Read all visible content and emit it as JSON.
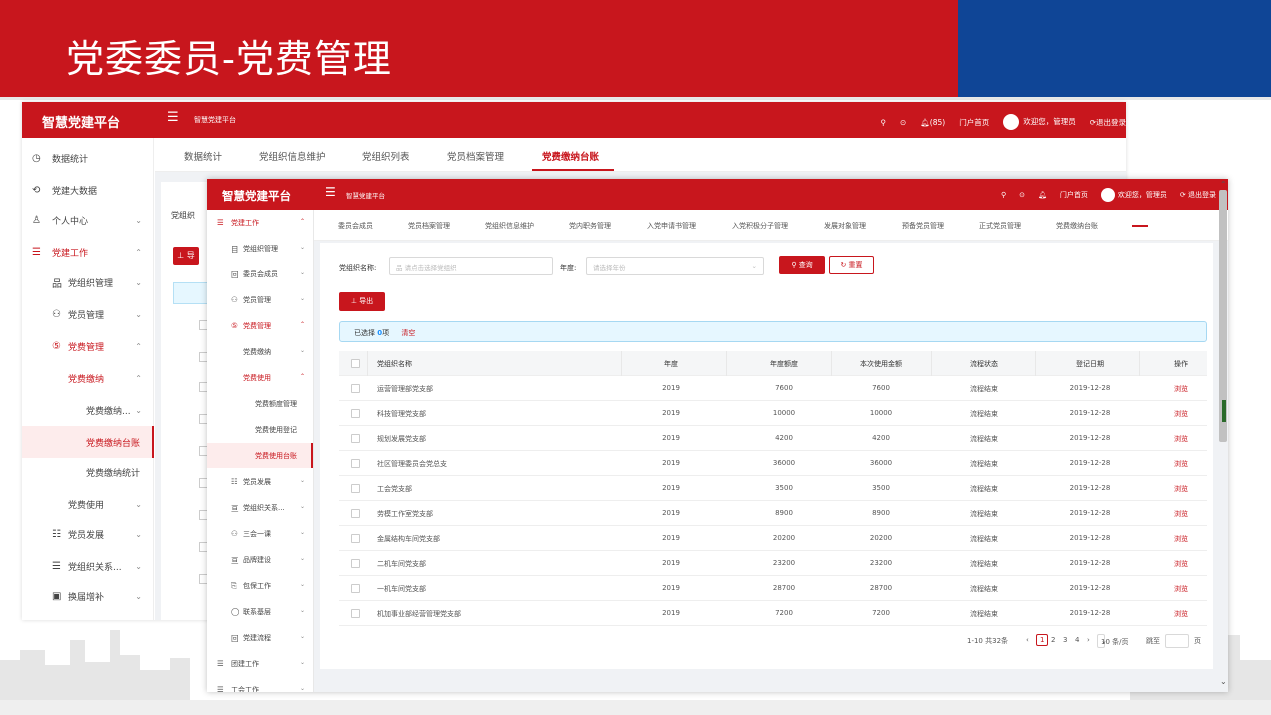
{
  "slide": {
    "title": "党委委员-党费管理"
  },
  "back_window": {
    "logo": "智慧党建平台",
    "brand": "智慧党建平台",
    "header_right": {
      "notifications": "(85)",
      "portal": "门户首页",
      "welcome": "欢迎您，管理员",
      "logout": "退出登录"
    },
    "sidebar": [
      {
        "icon": "◷",
        "label": "数据统计",
        "arrow": ""
      },
      {
        "icon": "⟲",
        "label": "党建大数据",
        "arrow": ""
      },
      {
        "icon": "♙",
        "label": "个人中心",
        "arrow": "⌄"
      },
      {
        "icon": "☰",
        "label": "党建工作",
        "arrow": "⌃"
      },
      {
        "icon": "品",
        "label": "党组织管理",
        "arrow": "⌄"
      },
      {
        "icon": "⚇",
        "label": "党员管理",
        "arrow": "⌄"
      },
      {
        "icon": "⑤",
        "label": "党费管理",
        "arrow": "⌃"
      },
      {
        "icon": "",
        "label": "党费缴纳",
        "arrow": "⌃"
      },
      {
        "icon": "",
        "label": "党费缴纳...",
        "arrow": "⌄"
      },
      {
        "icon": "",
        "label": "党费缴纳台账",
        "arrow": ""
      },
      {
        "icon": "",
        "label": "党费缴纳统计",
        "arrow": ""
      },
      {
        "icon": "",
        "label": "党费使用",
        "arrow": "⌄"
      },
      {
        "icon": "☷",
        "label": "党员发展",
        "arrow": "⌄"
      },
      {
        "icon": "☰",
        "label": "党组织关系...",
        "arrow": "⌄"
      },
      {
        "icon": "▣",
        "label": "换届增补",
        "arrow": "⌄"
      }
    ],
    "tabs": [
      "数据统计",
      "党组织信息维护",
      "党组织列表",
      "党员档案管理",
      "党费缴纳台账"
    ],
    "card_label": "党组织",
    "export_label": "⊥ 导"
  },
  "front_window": {
    "logo": "智慧党建平台",
    "brand": "智慧党建平台",
    "header_right": {
      "portal": "门户首页",
      "welcome": "欢迎您，管理员",
      "logout": "退出登录"
    },
    "sidebar": [
      {
        "icon": "☰",
        "label": "党建工作",
        "arrow": "⌃"
      },
      {
        "icon": "目",
        "label": "党组织管理",
        "arrow": "⌄"
      },
      {
        "icon": "回",
        "label": "委员会成员",
        "arrow": "⌄"
      },
      {
        "icon": "⚇",
        "label": "党员管理",
        "arrow": "⌄"
      },
      {
        "icon": "⑤",
        "label": "党费管理",
        "arrow": "⌃"
      },
      {
        "icon": "",
        "label": "党费缴纳",
        "arrow": "⌄"
      },
      {
        "icon": "",
        "label": "党费使用",
        "arrow": "⌃"
      },
      {
        "icon": "",
        "label": "党费额度管理",
        "arrow": ""
      },
      {
        "icon": "",
        "label": "党费使用登记",
        "arrow": ""
      },
      {
        "icon": "",
        "label": "党费使用台账",
        "arrow": ""
      },
      {
        "icon": "☷",
        "label": "党员发展",
        "arrow": "⌄"
      },
      {
        "icon": "亘",
        "label": "党组织关系...",
        "arrow": "⌄"
      },
      {
        "icon": "⚇",
        "label": "三会一课",
        "arrow": "⌄"
      },
      {
        "icon": "亘",
        "label": "品牌建设",
        "arrow": "⌄"
      },
      {
        "icon": "⎘",
        "label": "包保工作",
        "arrow": "⌄"
      },
      {
        "icon": "◯",
        "label": "联系基层",
        "arrow": "⌄"
      },
      {
        "icon": "回",
        "label": "党建流程",
        "arrow": "⌄"
      },
      {
        "icon": "☰",
        "label": "团建工作",
        "arrow": "⌄"
      },
      {
        "icon": "☰",
        "label": "工会工作",
        "arrow": "⌄"
      }
    ],
    "tabs": [
      "委员会成员",
      "党员档案管理",
      "党组织信息维护",
      "党内职务管理",
      "入党申请书管理",
      "入党积极分子管理",
      "发展对象管理",
      "预备党员管理",
      "正式党员管理",
      "党费缴纳台账"
    ],
    "filters": {
      "org_label": "党组织名称:",
      "org_placeholder": "请点击选择党组织",
      "year_label": "年度:",
      "year_placeholder": "请选择年份",
      "query_label": "查询",
      "reset_label": "重置"
    },
    "export_label": "导出",
    "alert": {
      "prefix": "已选择",
      "count": "0",
      "suffix": "项",
      "clear": "清空"
    },
    "table": {
      "headers": [
        "党组织名称",
        "年度",
        "年度额度",
        "本次使用金额",
        "流程状态",
        "登记日期",
        "操作"
      ],
      "rows": [
        [
          "运营管理部党支部",
          "2019",
          "7600",
          "7600",
          "流程结束",
          "2019-12-28",
          "浏览"
        ],
        [
          "科技管理党支部",
          "2019",
          "10000",
          "10000",
          "流程结束",
          "2019-12-28",
          "浏览"
        ],
        [
          "规划发展党支部",
          "2019",
          "4200",
          "4200",
          "流程结束",
          "2019-12-28",
          "浏览"
        ],
        [
          "社区管理委员会党总支",
          "2019",
          "36000",
          "36000",
          "流程结束",
          "2019-12-28",
          "浏览"
        ],
        [
          "工会党支部",
          "2019",
          "3500",
          "3500",
          "流程结束",
          "2019-12-28",
          "浏览"
        ],
        [
          "劳模工作室党支部",
          "2019",
          "8900",
          "8900",
          "流程结束",
          "2019-12-28",
          "浏览"
        ],
        [
          "金属结构车间党支部",
          "2019",
          "20200",
          "20200",
          "流程结束",
          "2019-12-28",
          "浏览"
        ],
        [
          "二机车间党支部",
          "2019",
          "23200",
          "23200",
          "流程结束",
          "2019-12-28",
          "浏览"
        ],
        [
          "一机车间党支部",
          "2019",
          "28700",
          "28700",
          "流程结束",
          "2019-12-28",
          "浏览"
        ],
        [
          "机加事业部经营管理党支部",
          "2019",
          "7200",
          "7200",
          "流程结束",
          "2019-12-28",
          "浏览"
        ]
      ]
    },
    "pager": {
      "total": "1-10 共32条",
      "pages": [
        "1",
        "2",
        "3",
        "4"
      ],
      "current": "1",
      "page_size": "10 条/页",
      "goto_label": "跳至",
      "page_unit": "页"
    }
  }
}
